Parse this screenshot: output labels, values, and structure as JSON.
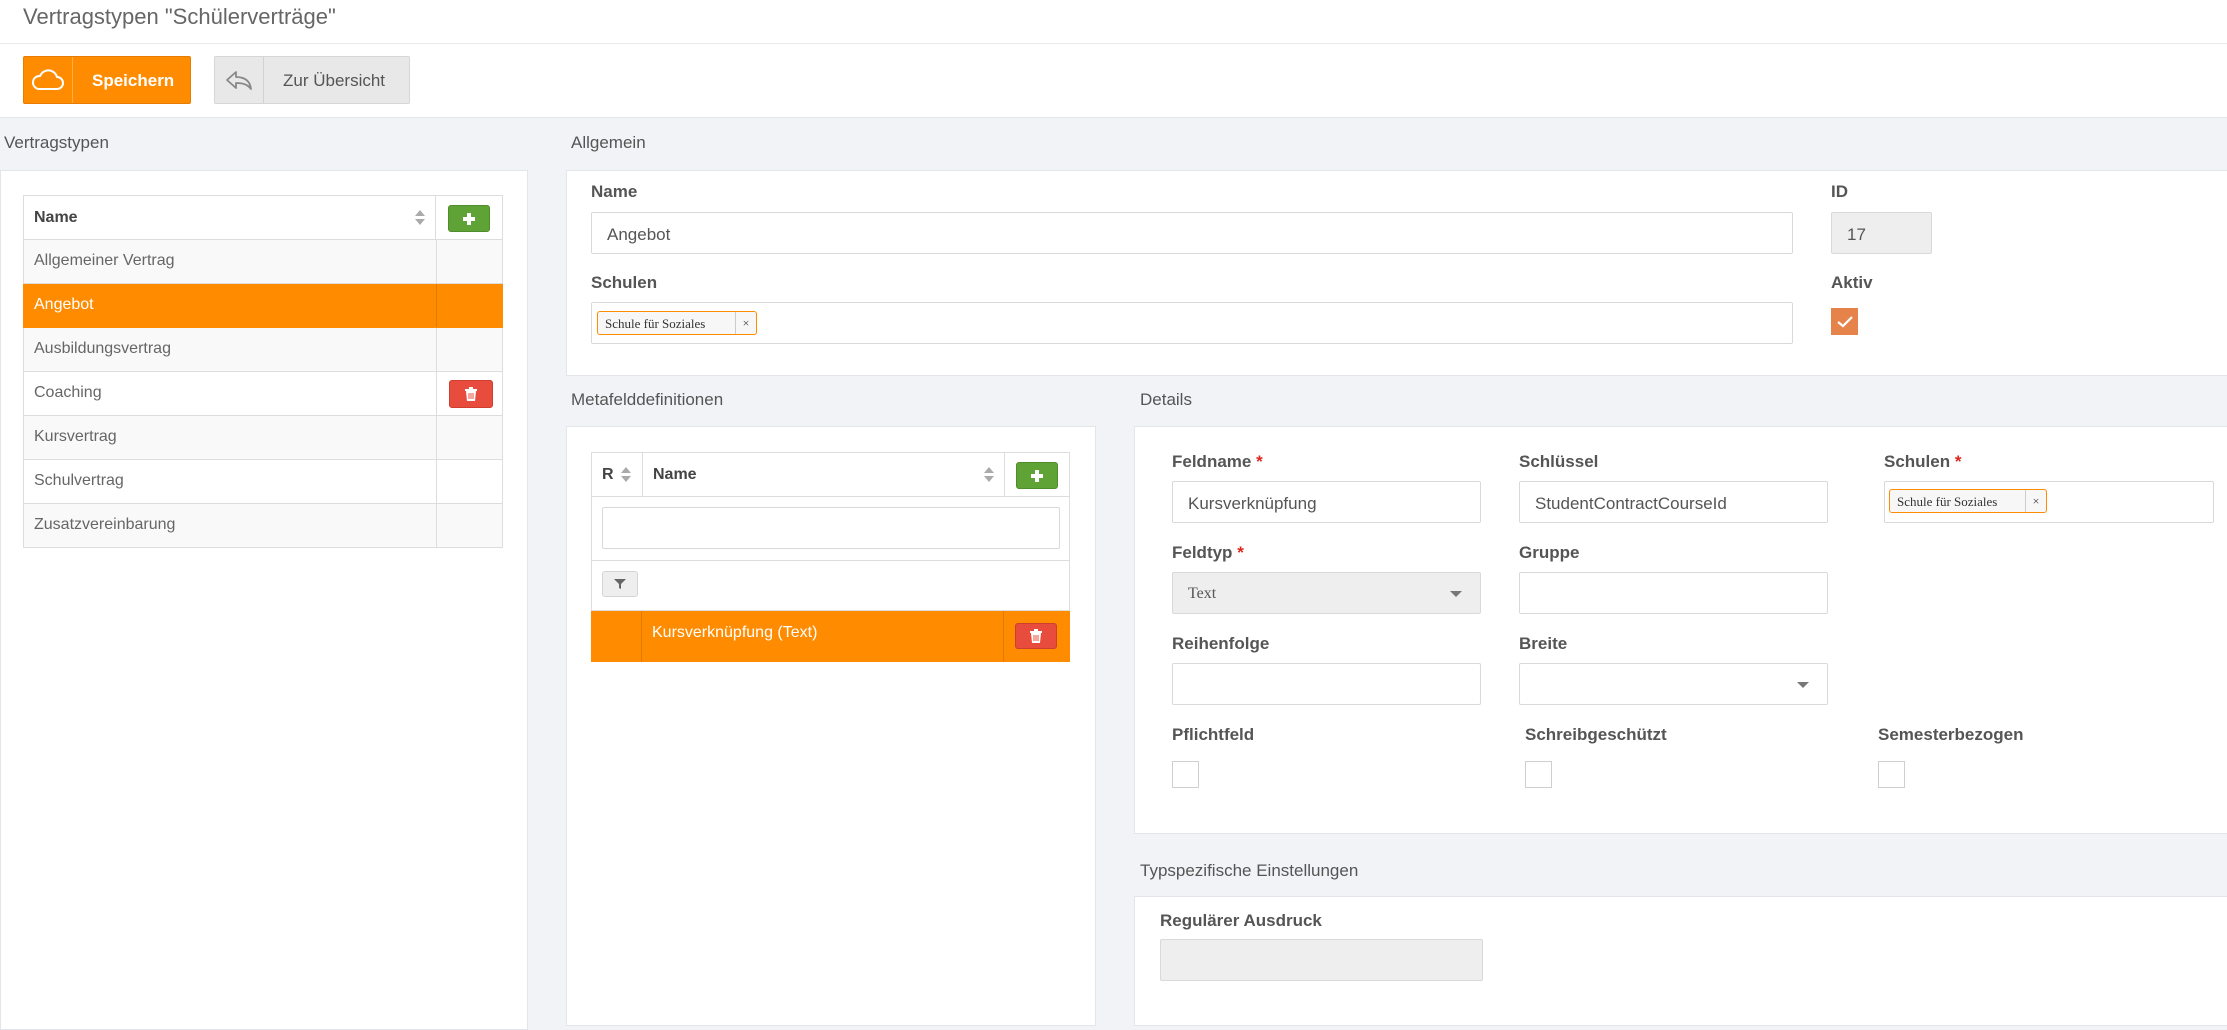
{
  "header": {
    "title": "Vertragstypen \"Schülerverträge\""
  },
  "toolbar": {
    "save_label": "Speichern",
    "back_label": "Zur Übersicht"
  },
  "contract_types": {
    "title": "Vertragstypen",
    "column_name": "Name",
    "rows": [
      "Allgemeiner Vertrag",
      "Angebot",
      "Ausbildungsvertrag",
      "Coaching",
      "Kursvertrag",
      "Schulvertrag",
      "Zusatzvereinbarung"
    ],
    "selected": "Angebot"
  },
  "general": {
    "title": "Allgemein",
    "name_label": "Name",
    "name_value": "Angebot",
    "id_label": "ID",
    "id_value": "17",
    "schools_label": "Schulen",
    "school_tag": "Schule für Soziales",
    "active_label": "Aktiv",
    "active_checked": true
  },
  "meta_fields": {
    "title": "Metafelddefinitionen",
    "col_r": "R",
    "col_name": "Name",
    "search_value": "",
    "rows": [
      "Kursverknüpfung (Text)"
    ]
  },
  "details": {
    "title": "Details",
    "fieldname_label": "Feldname",
    "fieldname_value": "Kursverknüpfung",
    "key_label": "Schlüssel",
    "key_value": "StudentContractCourseId",
    "schools_label": "Schulen",
    "school_tag": "Schule für Soziales",
    "fieldtype_label": "Feldtyp",
    "fieldtype_value": "Text",
    "group_label": "Gruppe",
    "group_value": "",
    "order_label": "Reihenfolge",
    "order_value": "",
    "width_label": "Breite",
    "width_value": "",
    "required_label": "Pflichtfeld",
    "readonly_label": "Schreibgeschützt",
    "semester_label": "Semesterbezogen"
  },
  "type_settings": {
    "title": "Typspezifische Einstellungen",
    "regex_label": "Regulärer Ausdruck",
    "regex_value": ""
  },
  "colors": {
    "accent": "#ff8b00",
    "add": "#5fa236",
    "delete": "#e74c3c"
  }
}
